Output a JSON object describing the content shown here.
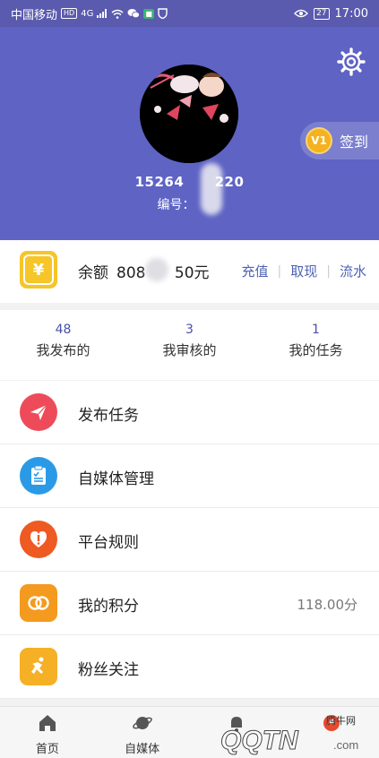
{
  "status_bar": {
    "carrier": "中国移动",
    "hd": "HD",
    "network": "4G",
    "battery": "27",
    "time": "17:00"
  },
  "header": {
    "phone_masked": "15264 220",
    "phone_part1": "15264",
    "phone_part2": "220",
    "id_label": "编号：",
    "checkin_level": "V1",
    "checkin_label": "签到"
  },
  "balance": {
    "label": "余额",
    "amount_part1": "808",
    "amount_part2": "50元",
    "links": [
      "充值",
      "取现",
      "流水"
    ]
  },
  "stats": [
    {
      "count": "48",
      "label": "我发布的"
    },
    {
      "count": "3",
      "label": "我审核的"
    },
    {
      "count": "1",
      "label": "我的任务"
    }
  ],
  "menu": [
    {
      "label": "发布任务",
      "value": "",
      "icon": "paper-plane-icon",
      "color": "#ee4b5a"
    },
    {
      "label": "自媒体管理",
      "value": "",
      "icon": "clipboard-icon",
      "color": "#2b9ae6"
    },
    {
      "label": "平台规则",
      "value": "",
      "icon": "rules-icon",
      "color": "#ee5a22"
    },
    {
      "label": "我的积分",
      "value": "118.00分",
      "icon": "points-icon",
      "color": "#f49a1e"
    },
    {
      "label": "粉丝关注",
      "value": "",
      "icon": "runner-icon",
      "color": "#f5b026"
    }
  ],
  "bottom_nav": [
    {
      "label": "首页",
      "icon": "home-icon"
    },
    {
      "label": "自媒体",
      "icon": "planet-icon"
    },
    {
      "label": "",
      "icon": "bell-icon"
    },
    {
      "label": "",
      "icon": "profile-icon"
    }
  ],
  "watermark": {
    "brand": "腾牛网",
    "text": "QQTN",
    "suffix": ".com"
  },
  "colors": {
    "header_bg": "#5e63c4",
    "link": "#4d62b3",
    "stat_num": "#4a4fa8",
    "checkin_badge": "#f5b21f"
  }
}
